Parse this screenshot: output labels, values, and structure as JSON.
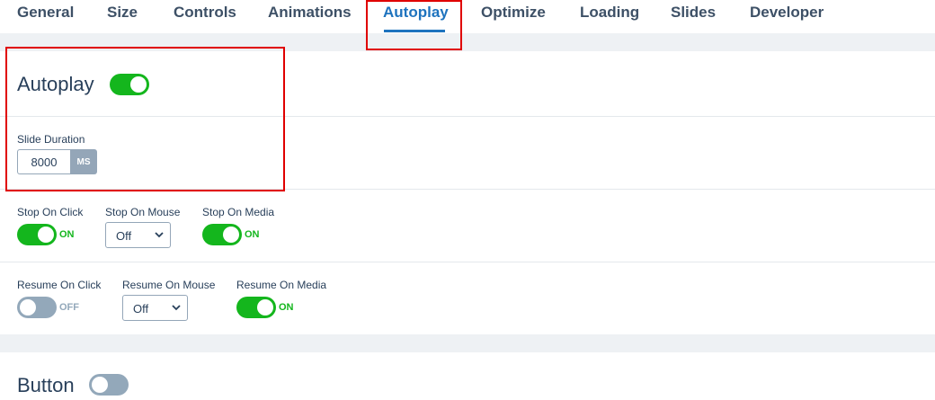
{
  "tabs": [
    {
      "label": "General"
    },
    {
      "label": "Size"
    },
    {
      "label": "Controls"
    },
    {
      "label": "Animations"
    },
    {
      "label": "Autoplay"
    },
    {
      "label": "Optimize"
    },
    {
      "label": "Loading"
    },
    {
      "label": "Slides"
    },
    {
      "label": "Developer"
    }
  ],
  "active_tab": "Autoplay",
  "autoplay": {
    "title": "Autoplay",
    "enabled": true,
    "slide_duration": {
      "label": "Slide Duration",
      "value": "8000",
      "unit": "MS"
    },
    "stop_on_click": {
      "label": "Stop On Click",
      "state": "ON"
    },
    "stop_on_mouse": {
      "label": "Stop On Mouse",
      "value": "Off"
    },
    "stop_on_media": {
      "label": "Stop On Media",
      "state": "ON"
    },
    "resume_on_click": {
      "label": "Resume On Click",
      "state": "OFF"
    },
    "resume_on_mouse": {
      "label": "Resume On Mouse",
      "value": "Off"
    },
    "resume_on_media": {
      "label": "Resume On Media",
      "state": "ON"
    }
  },
  "button_section": {
    "title": "Button",
    "enabled": false
  },
  "colors": {
    "accent": "#1e73be",
    "toggle_on": "#14b61d",
    "toggle_off": "#93a8ba",
    "highlight": "#e00000"
  }
}
